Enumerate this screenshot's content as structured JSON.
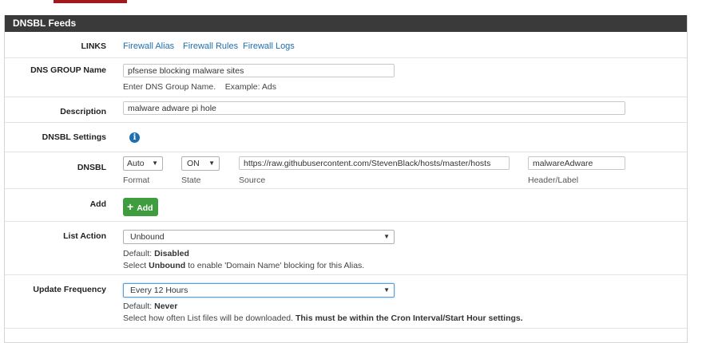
{
  "panel": {
    "title": "DNSBL Feeds"
  },
  "links": {
    "label": "LINKS",
    "items": [
      "Firewall Alias",
      "Firewall Rules",
      "Firewall Logs"
    ]
  },
  "dns_group": {
    "label": "DNS GROUP Name",
    "value": "pfsense blocking malware sites",
    "help": "Enter DNS Group Name.    Example: Ads"
  },
  "description": {
    "label": "Description",
    "value": "malware adware pi hole"
  },
  "dnsbl_settings": {
    "label": "DNSBL Settings",
    "icon": "info-icon"
  },
  "dnsbl": {
    "label": "DNSBL",
    "format_value": "Auto",
    "format_label": "Format",
    "state_value": "ON",
    "state_label": "State",
    "source_value": "https://raw.githubusercontent.com/StevenBlack/hosts/master/hosts",
    "source_label": "Source",
    "header_value": "malwareAdware",
    "header_label": "Header/Label"
  },
  "add": {
    "label": "Add",
    "button_label": "Add"
  },
  "list_action": {
    "label": "List Action",
    "value": "Unbound",
    "default_prefix": "Default: ",
    "default_value": "Disabled",
    "help_prefix": "Select ",
    "help_bold": "Unbound",
    "help_suffix": " to enable 'Domain Name' blocking for this Alias."
  },
  "update_frequency": {
    "label": "Update Frequency",
    "value": "Every 12 Hours",
    "default_prefix": "Default: ",
    "default_value": "Never",
    "help_text": "Select how often List files will be downloaded. ",
    "help_bold": "This must be within the Cron Interval/Start Hour settings."
  }
}
